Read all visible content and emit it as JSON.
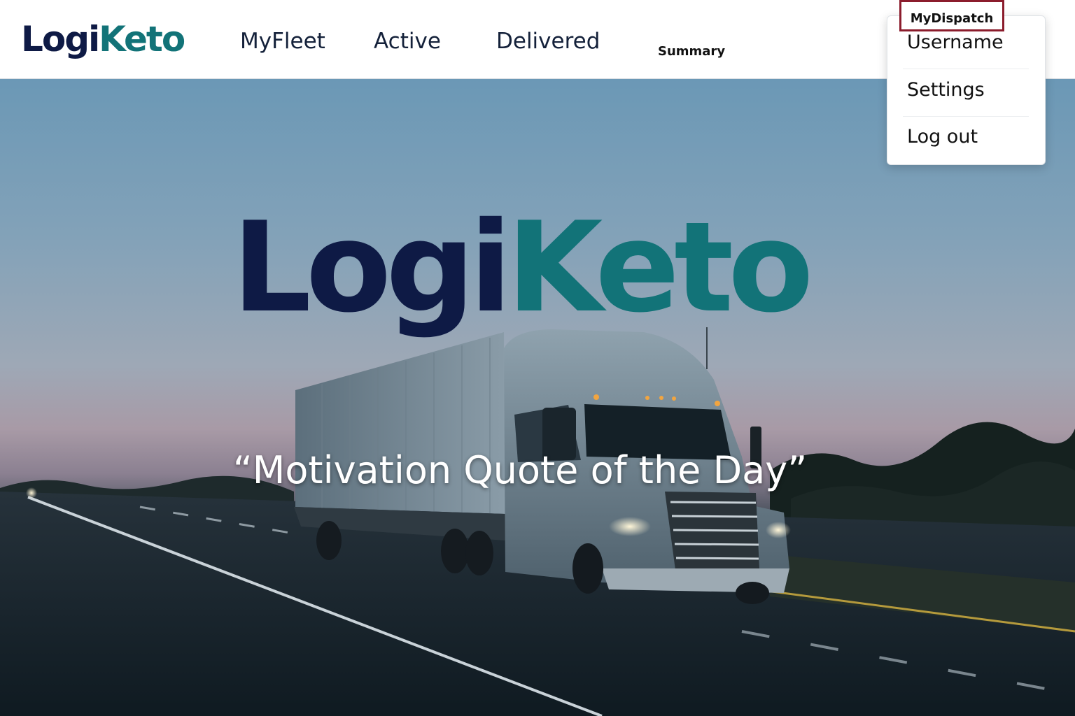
{
  "brand": {
    "part1": "Logi",
    "part2": "Keto",
    "color_dark": "#0e1a45",
    "color_teal": "#127378"
  },
  "nav": {
    "items": [
      {
        "label": "MyFleet"
      },
      {
        "label": "Active"
      },
      {
        "label": "Delivered"
      },
      {
        "label": "Summary"
      }
    ]
  },
  "account_menu": {
    "trigger_label": "MyDispatch",
    "highlight_color": "#8b1c2c",
    "items": [
      {
        "label": "Username"
      },
      {
        "label": "Settings"
      },
      {
        "label": "Log out"
      }
    ]
  },
  "hero": {
    "logo_part1": "Logi",
    "logo_part2": "Keto",
    "quote": "“Motivation Quote of the Day”",
    "image": "truck-on-highway-at-dusk"
  }
}
